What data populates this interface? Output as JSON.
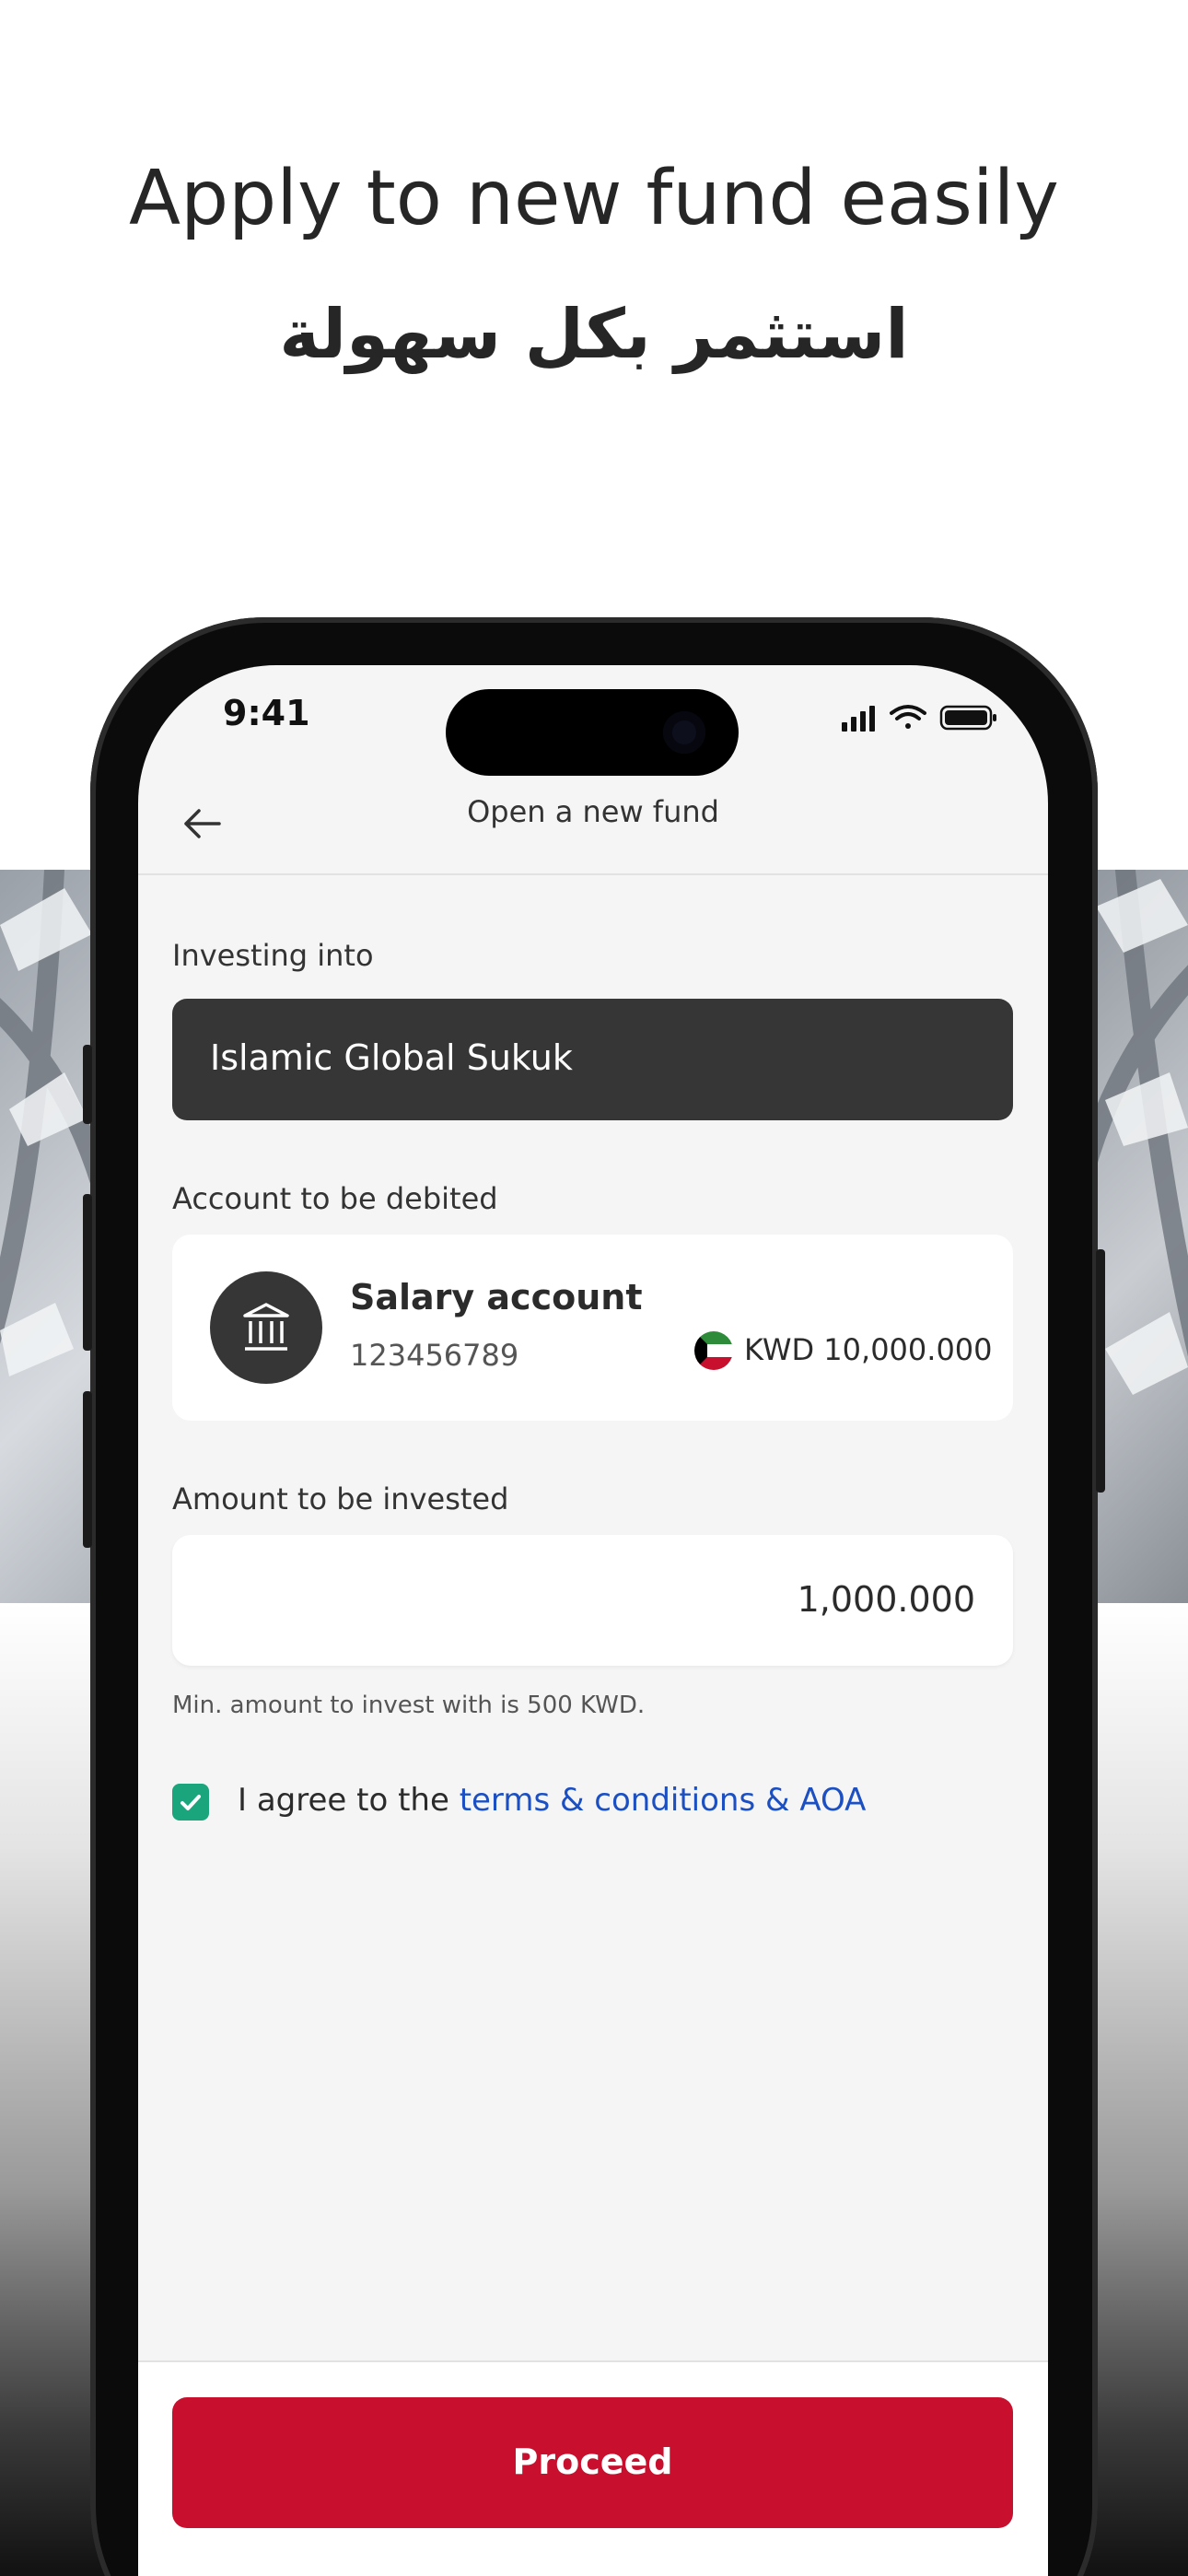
{
  "promo": {
    "title_en": "Apply to new fund easily",
    "title_ar": "استثمر بكل سهولة"
  },
  "status_bar": {
    "time": "9:41",
    "icons": [
      "signal-icon",
      "wifi-icon",
      "battery-icon"
    ]
  },
  "header": {
    "back_icon": "arrow-left-icon",
    "title": "Open a new fund"
  },
  "investing": {
    "label": "Investing into",
    "fund_name": "Islamic Global Sukuk"
  },
  "debit": {
    "label": "Account to be debited",
    "account_name": "Salary account",
    "account_number": "123456789",
    "balance": "KWD 10,000.000",
    "icon": "bank-icon",
    "flag_icon": "kuwait-flag-icon"
  },
  "amount": {
    "label": "Amount to be invested",
    "value": "1,000.000",
    "hint": "Min. amount to invest with is 500 KWD."
  },
  "agreement": {
    "checked": true,
    "prefix": "I agree to the ",
    "link": "terms & conditions & AOA"
  },
  "footer": {
    "proceed_label": "Proceed"
  },
  "colors": {
    "accent": "#c8102e",
    "dark_surface": "#363636",
    "check": "#1aa57c",
    "link": "#1b4fc2"
  }
}
